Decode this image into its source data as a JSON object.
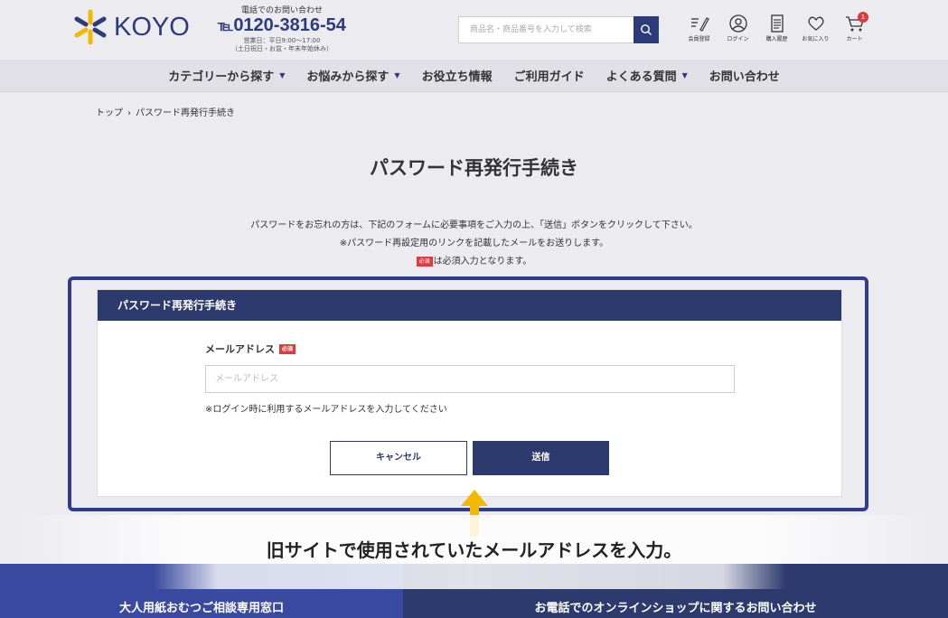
{
  "header": {
    "logo_text": "KOYO",
    "phone_label": "電話でのお問い合わせ",
    "phone_number": "0120-3816-54",
    "phone_hours_1": "営業日：平日9:00〜17:00",
    "phone_hours_2": "（土日祝日・お盆・年末年始休み）",
    "search_placeholder": "商品名・商品番号を入力して検索",
    "icons": [
      {
        "name": "member-register-icon",
        "label": "会員登録"
      },
      {
        "name": "login-icon",
        "label": "ログイン"
      },
      {
        "name": "purchase-history-icon",
        "label": "購入履歴"
      },
      {
        "name": "favorites-icon",
        "label": "お気に入り"
      },
      {
        "name": "cart-icon",
        "label": "カート",
        "badge": "1"
      }
    ]
  },
  "nav": {
    "items": [
      {
        "label": "カテゴリーから探す",
        "dropdown": true
      },
      {
        "label": "お悩みから探す",
        "dropdown": true
      },
      {
        "label": "お役立ち情報",
        "dropdown": false
      },
      {
        "label": "ご利用ガイド",
        "dropdown": false
      },
      {
        "label": "よくある質問",
        "dropdown": true
      },
      {
        "label": "お問い合わせ",
        "dropdown": false
      }
    ]
  },
  "breadcrumb": {
    "home": "トップ",
    "separator": "›",
    "current": "パスワード再発行手続き"
  },
  "page": {
    "title": "パスワード再発行手続き",
    "intro_1": "パスワードをお忘れの方は、下記のフォームに必要事項をご入力の上、「送信」ボタンをクリックして下さい。",
    "intro_2": "※パスワード再設定用のリンクを記載したメールをお送りします。",
    "required_tag": "必須",
    "intro_3": "は必須入力となります。"
  },
  "form": {
    "header": "パスワード再発行手続き",
    "email_label": "メールアドレス",
    "required_tag": "必須",
    "email_placeholder": "メールアドレス",
    "email_value": "",
    "help": "※ログイン時に利用するメールアドレスを入力してください",
    "cancel_label": "キャンセル",
    "send_label": "送信"
  },
  "annotation": {
    "caption": "旧サイトで使用されていたメールアドレスを入力。",
    "arrow_color": "#f5b800"
  },
  "footer": {
    "left": "大人用紙おむつご相談専用窓口",
    "right": "お電話でのオンラインショップに関するお問い合わせ"
  },
  "colors": {
    "brand": "#2d3a7c",
    "accent_yellow": "#f5b800",
    "required_red": "#e03a3a"
  }
}
